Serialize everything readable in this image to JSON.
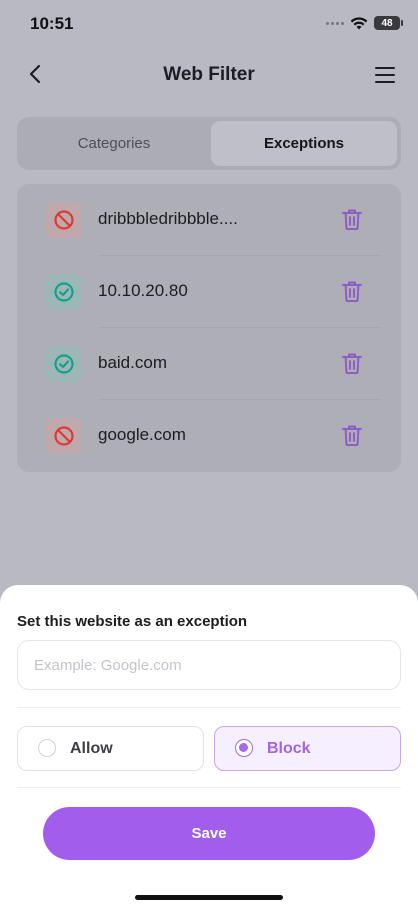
{
  "status_bar": {
    "time": "10:51",
    "battery": "48"
  },
  "nav": {
    "title": "Web Filter",
    "back_icon": "chevron-left-icon",
    "menu_icon": "hamburger-menu-icon"
  },
  "tabs": [
    {
      "label": "Categories",
      "selected": false
    },
    {
      "label": "Exceptions",
      "selected": true
    }
  ],
  "exceptions": [
    {
      "domain": "dribbbledribbble....",
      "status": "block",
      "icon": "block-icon"
    },
    {
      "domain": "10.10.20.80",
      "status": "allow",
      "icon": "check-circle-icon"
    },
    {
      "domain": "baid.com",
      "status": "allow",
      "icon": "check-circle-icon"
    },
    {
      "domain": "google.com",
      "status": "block",
      "icon": "block-icon"
    }
  ],
  "sheet": {
    "title": "Set this website as an exception",
    "input": {
      "value": "",
      "placeholder": "Example: Google.com"
    },
    "options": [
      {
        "label": "Allow",
        "selected": false
      },
      {
        "label": "Block",
        "selected": true
      }
    ],
    "save_label": "Save"
  },
  "colors": {
    "accent": "#a25ded",
    "block_red": "#d93b33",
    "allow_teal": "#13a08f"
  }
}
